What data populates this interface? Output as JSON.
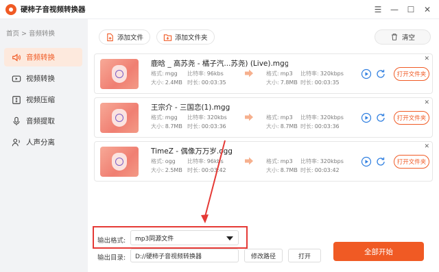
{
  "app": {
    "title": "硬柿子音视频转换器"
  },
  "window_controls": {
    "menu_icon": "☰",
    "minimize": "—",
    "maximize": "☐",
    "close": "✕"
  },
  "breadcrumb": {
    "home": "首页",
    "sep": ">",
    "current": "音频转换"
  },
  "sidebar": {
    "items": [
      {
        "label": "音频转换",
        "icon": "audio-icon",
        "active": true
      },
      {
        "label": "视频转换",
        "icon": "video-icon",
        "active": false
      },
      {
        "label": "视频压缩",
        "icon": "compress-icon",
        "active": false
      },
      {
        "label": "音频提取",
        "icon": "extract-icon",
        "active": false
      },
      {
        "label": "人声分离",
        "icon": "vocal-icon",
        "active": false
      }
    ]
  },
  "toolbar": {
    "add_file": "添加文件",
    "add_folder": "添加文件夹",
    "clear": "清空"
  },
  "labels": {
    "format": "格式:",
    "bitrate": "比特率:",
    "size": "大小:",
    "duration": "时长:",
    "open_folder": "打开文件夹",
    "close": "✕"
  },
  "files": [
    {
      "name": "鹿晗 _ 高苏尧 - 橘子汽...苏尧) (Live).mgg",
      "src_format": "mgg",
      "src_bitrate": "96kbs",
      "src_size": "2.4MB",
      "src_duration": "00:03:35",
      "dst_format": "mp3",
      "dst_bitrate": "320kbps",
      "dst_size": "7.8MB",
      "dst_duration": "00:03:35"
    },
    {
      "name": "王宗介 - 三国恋(1).mgg",
      "src_format": "mgg",
      "src_bitrate": "320kbs",
      "src_size": "8.7MB",
      "src_duration": "00:03:36",
      "dst_format": "mp3",
      "dst_bitrate": "320kbps",
      "dst_size": "8.7MB",
      "dst_duration": "00:03:36"
    },
    {
      "name": "TimeZ - 偶像万万岁.ogg",
      "src_format": "ogg",
      "src_bitrate": "96kbs",
      "src_size": "2.5MB",
      "src_duration": "00:03:42",
      "dst_format": "mp3",
      "dst_bitrate": "320kbps",
      "dst_size": "8.7MB",
      "dst_duration": "00:03:42"
    }
  ],
  "output": {
    "format_label": "输出格式:",
    "format_value": "mp3同源文件",
    "dir_label": "输出目录:",
    "dir_value": "D://硬柿子音视频转换器",
    "change_path": "修改路径",
    "open": "打开",
    "start_all": "全部开始"
  },
  "colors": {
    "accent": "#f05a24",
    "annotation": "#e53935"
  }
}
